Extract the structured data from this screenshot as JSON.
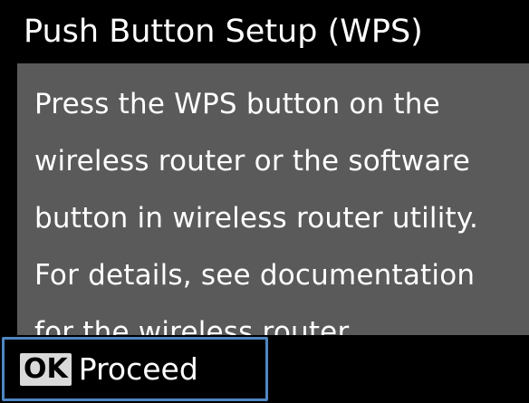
{
  "screen": {
    "title": "Push Button Setup (WPS)",
    "message_lines": [
      "Press the WPS button on the",
      "wireless router or the software",
      "button in wireless router utility.",
      "For details, see documentation",
      "for the wireless router."
    ]
  },
  "footer": {
    "ok_key": "OK",
    "proceed_label": "Proceed"
  },
  "colors": {
    "background": "#000000",
    "panel": "#5a5a5a",
    "highlight_border": "#4f86c2",
    "text": "#ffffff",
    "key_background": "#d9d9d9"
  }
}
